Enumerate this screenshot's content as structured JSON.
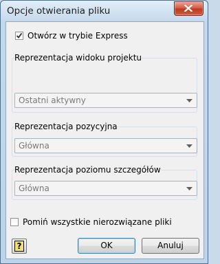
{
  "window": {
    "title": "Opcje otwierania pliku"
  },
  "options": {
    "express_mode": {
      "label": "Otwórz w trybie Express",
      "checked": true
    },
    "skip_unresolved": {
      "label": "Pomiń wszystkie nierozwiązane pliki",
      "checked": false
    }
  },
  "groups": [
    {
      "title": "Reprezentacja widoku projektu",
      "value": "Ostatni aktywny"
    },
    {
      "title": "Reprezentacja pozycyjna",
      "value": "Główna"
    },
    {
      "title": "Reprezentacja poziomu szczegółów",
      "value": "Główna"
    }
  ],
  "buttons": {
    "ok": "OK",
    "cancel": "Anuluj",
    "help_glyph": "?"
  }
}
